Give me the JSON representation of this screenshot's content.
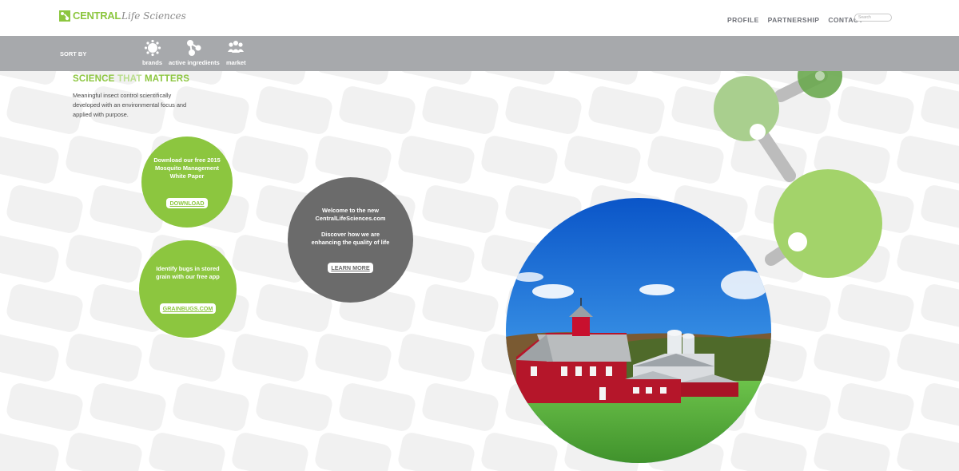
{
  "header": {
    "logo_bold": "CENTRAL",
    "logo_script": "Life Sciences",
    "logo_mark": "",
    "nav": [
      "PROFILE",
      "PARTNERSHIP",
      "CONTACT"
    ],
    "search_placeholder": "Search"
  },
  "sortbar": {
    "label": "SORT BY",
    "items": [
      {
        "label": "brands",
        "icon": "sun-icon"
      },
      {
        "label": "active ingredients",
        "icon": "molecule-icon"
      },
      {
        "label": "market",
        "icon": "people-icon"
      }
    ]
  },
  "tagline": {
    "w1": "SCIENCE",
    "w2": "THAT",
    "w3": "MATTERS",
    "text": "Meaningful insect control scientifically developed with an environmental focus and applied with purpose."
  },
  "circles": {
    "download": {
      "text": "Download our free 2015 Mosquito Management White Paper",
      "button": "DOWNLOAD"
    },
    "grain": {
      "text": "Identify bugs in stored grain with our free app",
      "button": "GRAINBUGS.COM"
    },
    "welcome": {
      "line1": "Welcome to the new CentralLifeSciences.com",
      "line2": "Discover how we are enhancing the quality of life",
      "button": "LEARN MORE"
    }
  },
  "colors": {
    "green": "#8cc63f",
    "gray_bar": "#a7a9ac",
    "dark_circle": "#6b6b6b"
  }
}
